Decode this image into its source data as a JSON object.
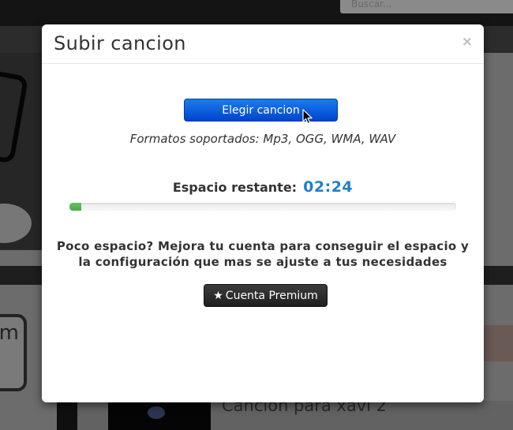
{
  "background": {
    "search_placeholder": "Buscar...",
    "keycap_text": "m",
    "song_title": "Cancion para xavi 2"
  },
  "modal": {
    "title": "Subir cancion",
    "close_label": "×",
    "choose_button_label": "Elegir cancion",
    "formats_text": "Formatos soportados: Mp3, OGG, WMA, WAV",
    "space_label": "Espacio restante:",
    "space_value": "02:24",
    "progress_fraction": 0.03,
    "upgrade_line_1": "Poco espacio? Mejora tu cuenta para conseguir el espacio y",
    "upgrade_line_2": "la configuración que mas se ajuste a tus necesidades",
    "premium_button_icon": "star-icon",
    "premium_button_label": "Cuenta Premium"
  },
  "colors": {
    "primary_button": "#0044cc",
    "space_value": "#1f7fd0",
    "progress_fill": "#5cb85c",
    "premium_button": "#222222"
  }
}
